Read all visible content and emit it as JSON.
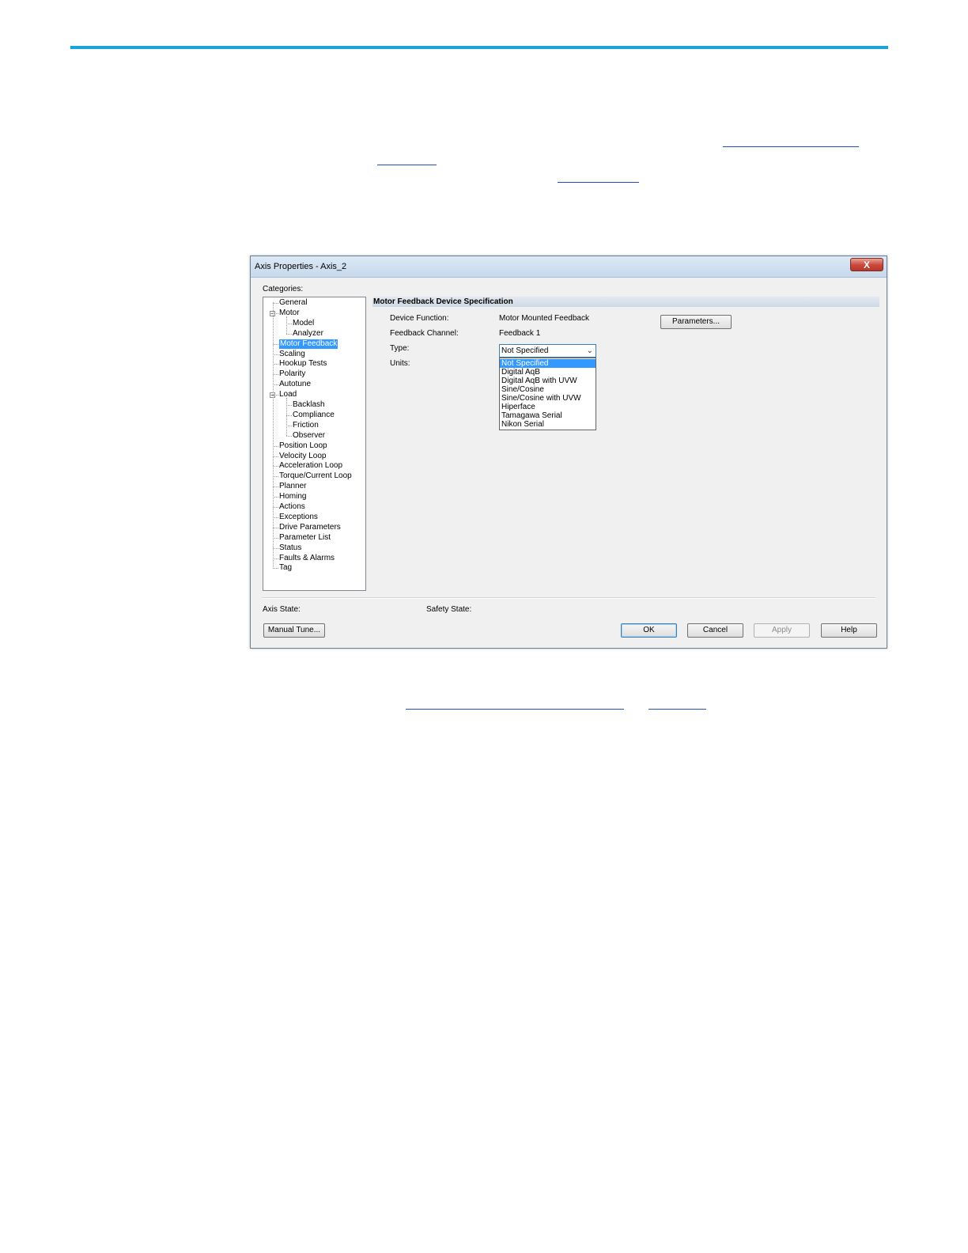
{
  "dialog": {
    "title": "Axis Properties - Axis_2",
    "close_label": "X",
    "categories_label": "Categories:",
    "tree": [
      {
        "label": "General",
        "level": 0
      },
      {
        "label": "Motor",
        "level": 0,
        "expander": "−"
      },
      {
        "label": "Model",
        "level": 1
      },
      {
        "label": "Analyzer",
        "level": 1
      },
      {
        "label": "Motor Feedback",
        "level": 0,
        "selected": true
      },
      {
        "label": "Scaling",
        "level": 0
      },
      {
        "label": "Hookup Tests",
        "level": 0
      },
      {
        "label": "Polarity",
        "level": 0
      },
      {
        "label": "Autotune",
        "level": 0
      },
      {
        "label": "Load",
        "level": 0,
        "expander": "−"
      },
      {
        "label": "Backlash",
        "level": 1
      },
      {
        "label": "Compliance",
        "level": 1
      },
      {
        "label": "Friction",
        "level": 1
      },
      {
        "label": "Observer",
        "level": 1
      },
      {
        "label": "Position Loop",
        "level": 0
      },
      {
        "label": "Velocity Loop",
        "level": 0
      },
      {
        "label": "Acceleration Loop",
        "level": 0
      },
      {
        "label": "Torque/Current Loop",
        "level": 0
      },
      {
        "label": "Planner",
        "level": 0
      },
      {
        "label": "Homing",
        "level": 0
      },
      {
        "label": "Actions",
        "level": 0
      },
      {
        "label": "Exceptions",
        "level": 0
      },
      {
        "label": "Drive Parameters",
        "level": 0
      },
      {
        "label": "Parameter List",
        "level": 0
      },
      {
        "label": "Status",
        "level": 0
      },
      {
        "label": "Faults & Alarms",
        "level": 0
      },
      {
        "label": "Tag",
        "level": 0
      }
    ],
    "section_title": "Motor Feedback Device Specification",
    "device_function_label": "Device Function:",
    "device_function_value": "Motor Mounted Feedback",
    "feedback_channel_label": "Feedback Channel:",
    "feedback_channel_value": "Feedback 1",
    "type_label": "Type:",
    "units_label": "Units:",
    "parameters_button": "Parameters...",
    "type_select": {
      "value": "Not Specified",
      "options": [
        "Not Specified",
        "Digital AqB",
        "Digital AqB with UVW",
        "Sine/Cosine",
        "Sine/Cosine with UVW",
        "Hiperface",
        "Tamagawa Serial",
        "Nikon Serial"
      ],
      "selected_index": 0
    },
    "axis_state_label": "Axis State:",
    "safety_state_label": "Safety State:",
    "buttons": {
      "manual_tune": "Manual Tune...",
      "ok": "OK",
      "cancel": "Cancel",
      "apply": "Apply",
      "help": "Help"
    }
  },
  "colors": {
    "accent_rule": "#1ba3dd",
    "selection": "#3399ff",
    "link_underline": "#1f4fb8"
  },
  "icons": {
    "close": "close-icon",
    "dropdown": "chevron-down-icon",
    "tree_expander": "collapse-minus-icon"
  }
}
